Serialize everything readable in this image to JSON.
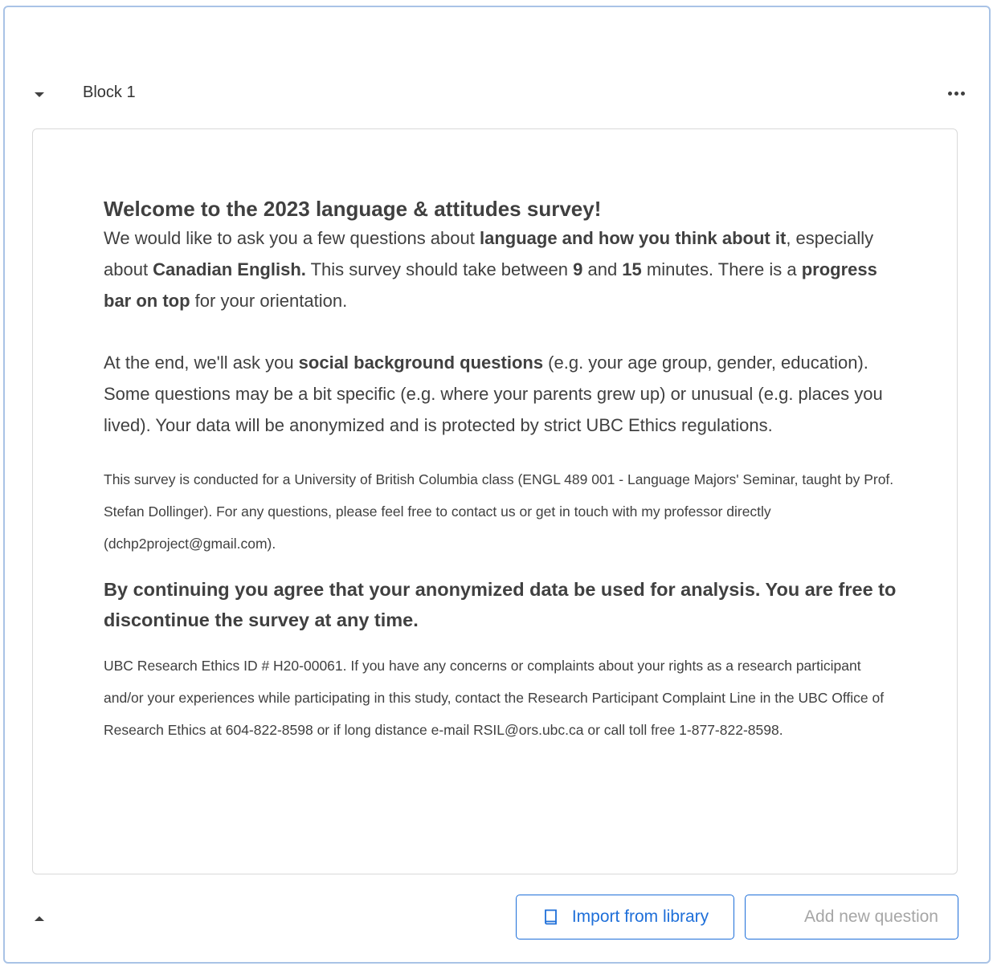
{
  "block": {
    "title": "Block 1"
  },
  "question": {
    "welcome_title": "Welcome to the 2023 language & attitudes survey!",
    "intro": {
      "t1": "We would like to ask you a few questions about ",
      "b1": "language and how you think about it",
      "t2": ", especially about ",
      "b2": "Canadian English.",
      "t3": " This survey should take between ",
      "b3": "9",
      "t4": " and ",
      "b4": "15",
      "t5": " minutes. There is a ",
      "b5": "progress bar on top",
      "t6": " for your orientation."
    },
    "background": {
      "t1": "At the end, we'll ask you ",
      "b1": "social background questions",
      "t2": " (e.g. your age group, gender, education). Some questions may be a bit specific (e.g. where your parents grew up) or unusual (e.g. places you lived). Your data will be anonymized and is protected by strict UBC Ethics regulations."
    },
    "class_info": "This survey is conducted for a University of British Columbia class (ENGL 489 001 - Language Majors' Seminar, taught by Prof. Stefan Dollinger). For any questions, please feel free to contact us or get in touch with my professor directly (dchp2project@gmail.com).",
    "consent": "By continuing you agree that your anonymized data be used for analysis. You are free to discontinue the survey at any time.",
    "ethics": "UBC Research Ethics ID # H20-00061. If you have any concerns or complaints about your rights as a research participant and/or your experiences while participating in this study, contact the Research Participant Complaint Line in the UBC Office of Research Ethics at 604-822-8598 or if long distance e-mail RSIL@ors.ubc.ca or call toll free 1-877-822-8598."
  },
  "actions": {
    "import_label": "Import from library",
    "add_label": "Add new question"
  },
  "colors": {
    "accent": "#1e6fd9",
    "block_border": "#a9c3e6",
    "text": "#404040",
    "muted": "#a6a6a6"
  },
  "icons": {
    "collapse": "chevron-down-icon",
    "expand": "chevron-up-icon",
    "more": "more-horizontal-icon",
    "import": "book-icon"
  }
}
